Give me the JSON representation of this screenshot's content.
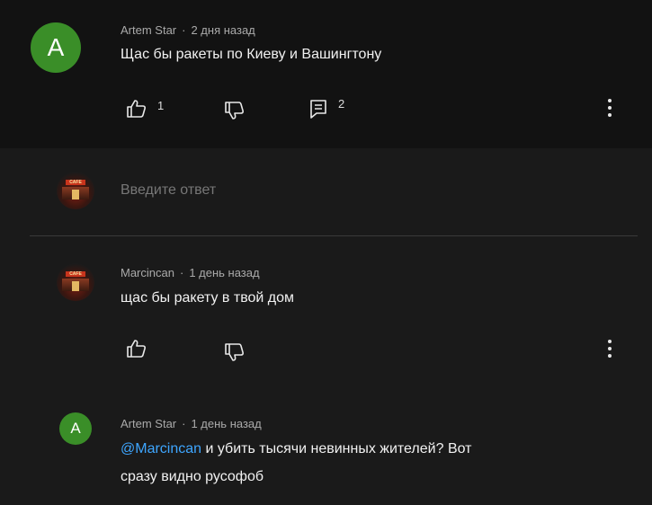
{
  "comments": [
    {
      "author": "Artem Star",
      "time": "2 дня назад",
      "avatar_letter": "A",
      "avatar_color": "#3a8e28",
      "text": "Щас бы ракеты по Киеву и Вашингтону",
      "likes": "1",
      "replies": "2"
    },
    {
      "author": "Marcincan",
      "time": "1 день назад",
      "avatar_icon": "storefront-photo-avatar",
      "text": "щас бы ракету в твой дом"
    },
    {
      "author": "Artem Star",
      "time": "1 день назад",
      "avatar_letter": "A",
      "avatar_color": "#3a8e28",
      "mention": "@Marcincan",
      "text_line1": " и убить тысячи невинных жителей? Вот",
      "text_line2": "сразу видно русофоб"
    }
  ],
  "reply_input": {
    "placeholder": "Введите ответ"
  },
  "avatar_photo_sign": "CAFE",
  "icons": {
    "like": "thumb-up-icon",
    "dislike": "thumb-down-icon",
    "reply": "comment-icon",
    "more": "more-vert-icon"
  },
  "colors": {
    "text": "#f1f1f1",
    "meta": "#aaaaaa",
    "mention": "#3ea6ff",
    "avatar_green": "#3a8e28"
  }
}
